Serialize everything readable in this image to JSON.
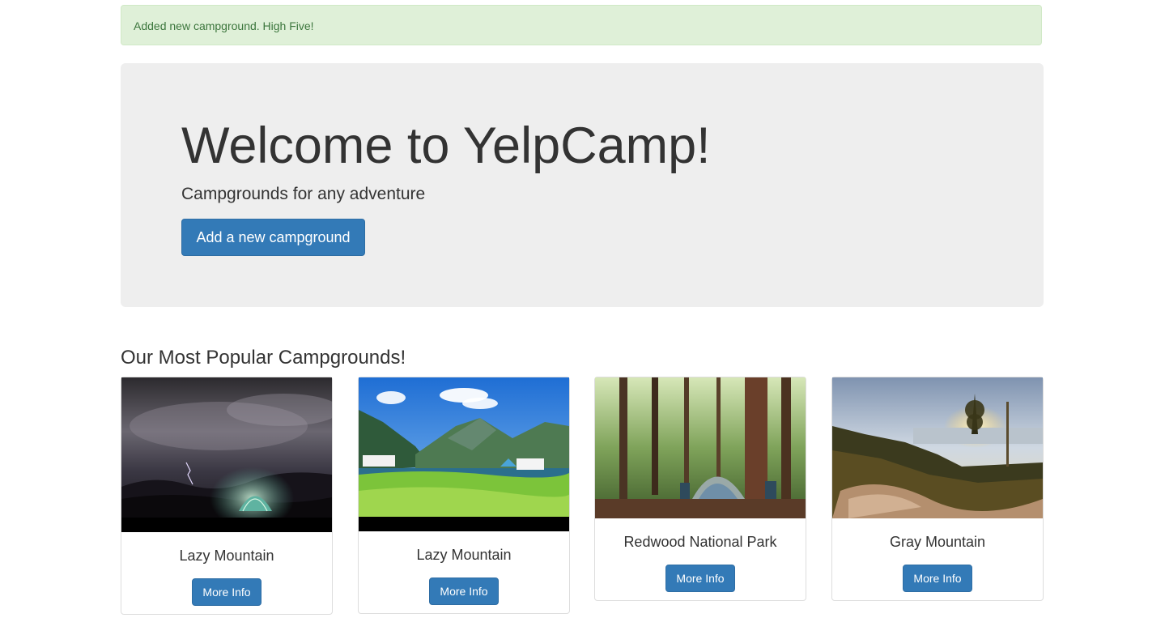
{
  "alert": {
    "message": "Added new campground. High Five!"
  },
  "jumbotron": {
    "title": "Welcome to YelpCamp!",
    "subtitle": "Campgrounds for any adventure",
    "button_label": "Add a new campground"
  },
  "section": {
    "title": "Our Most Popular Campgrounds!"
  },
  "campgrounds": [
    {
      "name": "Lazy Mountain",
      "button_label": "More Info",
      "image": "night-storm-tent-photo"
    },
    {
      "name": "Lazy Mountain",
      "button_label": "More Info",
      "image": "fjord-campsite-photo"
    },
    {
      "name": "Redwood National Park",
      "button_label": "More Info",
      "image": "forest-tent-photo"
    },
    {
      "name": "Gray Mountain",
      "button_label": "More Info",
      "image": "lake-sunset-photo"
    }
  ],
  "colors": {
    "primary": "#337ab7",
    "alert_bg": "#dff0d8",
    "alert_text": "#3c763d",
    "jumbotron_bg": "#eeeeee"
  }
}
